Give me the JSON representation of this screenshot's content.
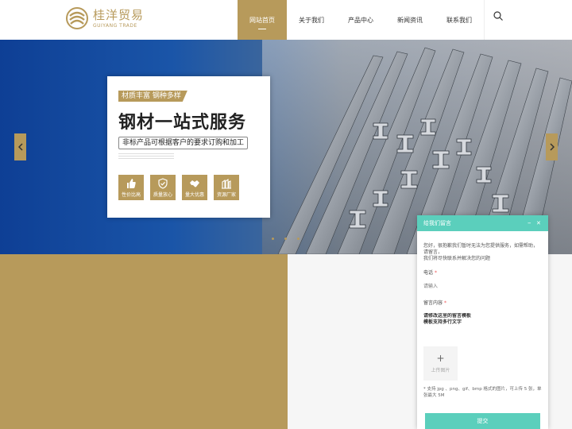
{
  "logo": {
    "name_cn": "桂洋贸易",
    "name_en": "GUIYANG TRADE"
  },
  "nav": {
    "items": [
      {
        "label": "网站首页"
      },
      {
        "label": "关于我们"
      },
      {
        "label": "产品中心"
      },
      {
        "label": "新闻资讯"
      },
      {
        "label": "联系我们"
      }
    ]
  },
  "banner": {
    "tag": "材质丰富 钢种多样",
    "title": "钢材一站式服务",
    "subtitle": "非标产品可根据客户的要求订购和加工",
    "features": [
      {
        "label": "性价比高",
        "icon": "thumbs-up-icon"
      },
      {
        "label": "质量放心",
        "icon": "shield-icon"
      },
      {
        "label": "量大优惠",
        "icon": "handshake-icon"
      },
      {
        "label": "资源厂家",
        "icon": "factory-icon"
      }
    ]
  },
  "widget": {
    "title": "给我们留言",
    "intro_line1": "您好，很抱歉我们暂时无法为您提供服务，如需帮助，请留言，",
    "intro_line2": "我们将尽快联系并解决您的问题",
    "phone_label": "电话",
    "required_mark": "*",
    "phone_placeholder": "请输入",
    "content_label": "留言内容",
    "content_value": "请修改这里的留言模板\n模板支持多行文字",
    "upload_label": "上传图片",
    "upload_plus": "+",
    "note": "* 支持 jpg 、png、gif、bmp 格式的图片，可上传 5 张，单张最大 5M",
    "submit_label": "提交",
    "minimize": "–",
    "close": "✕"
  },
  "colors": {
    "gold": "#b79a5b",
    "teal": "#5bcfbc",
    "banner_blue": "#0e3f95"
  }
}
